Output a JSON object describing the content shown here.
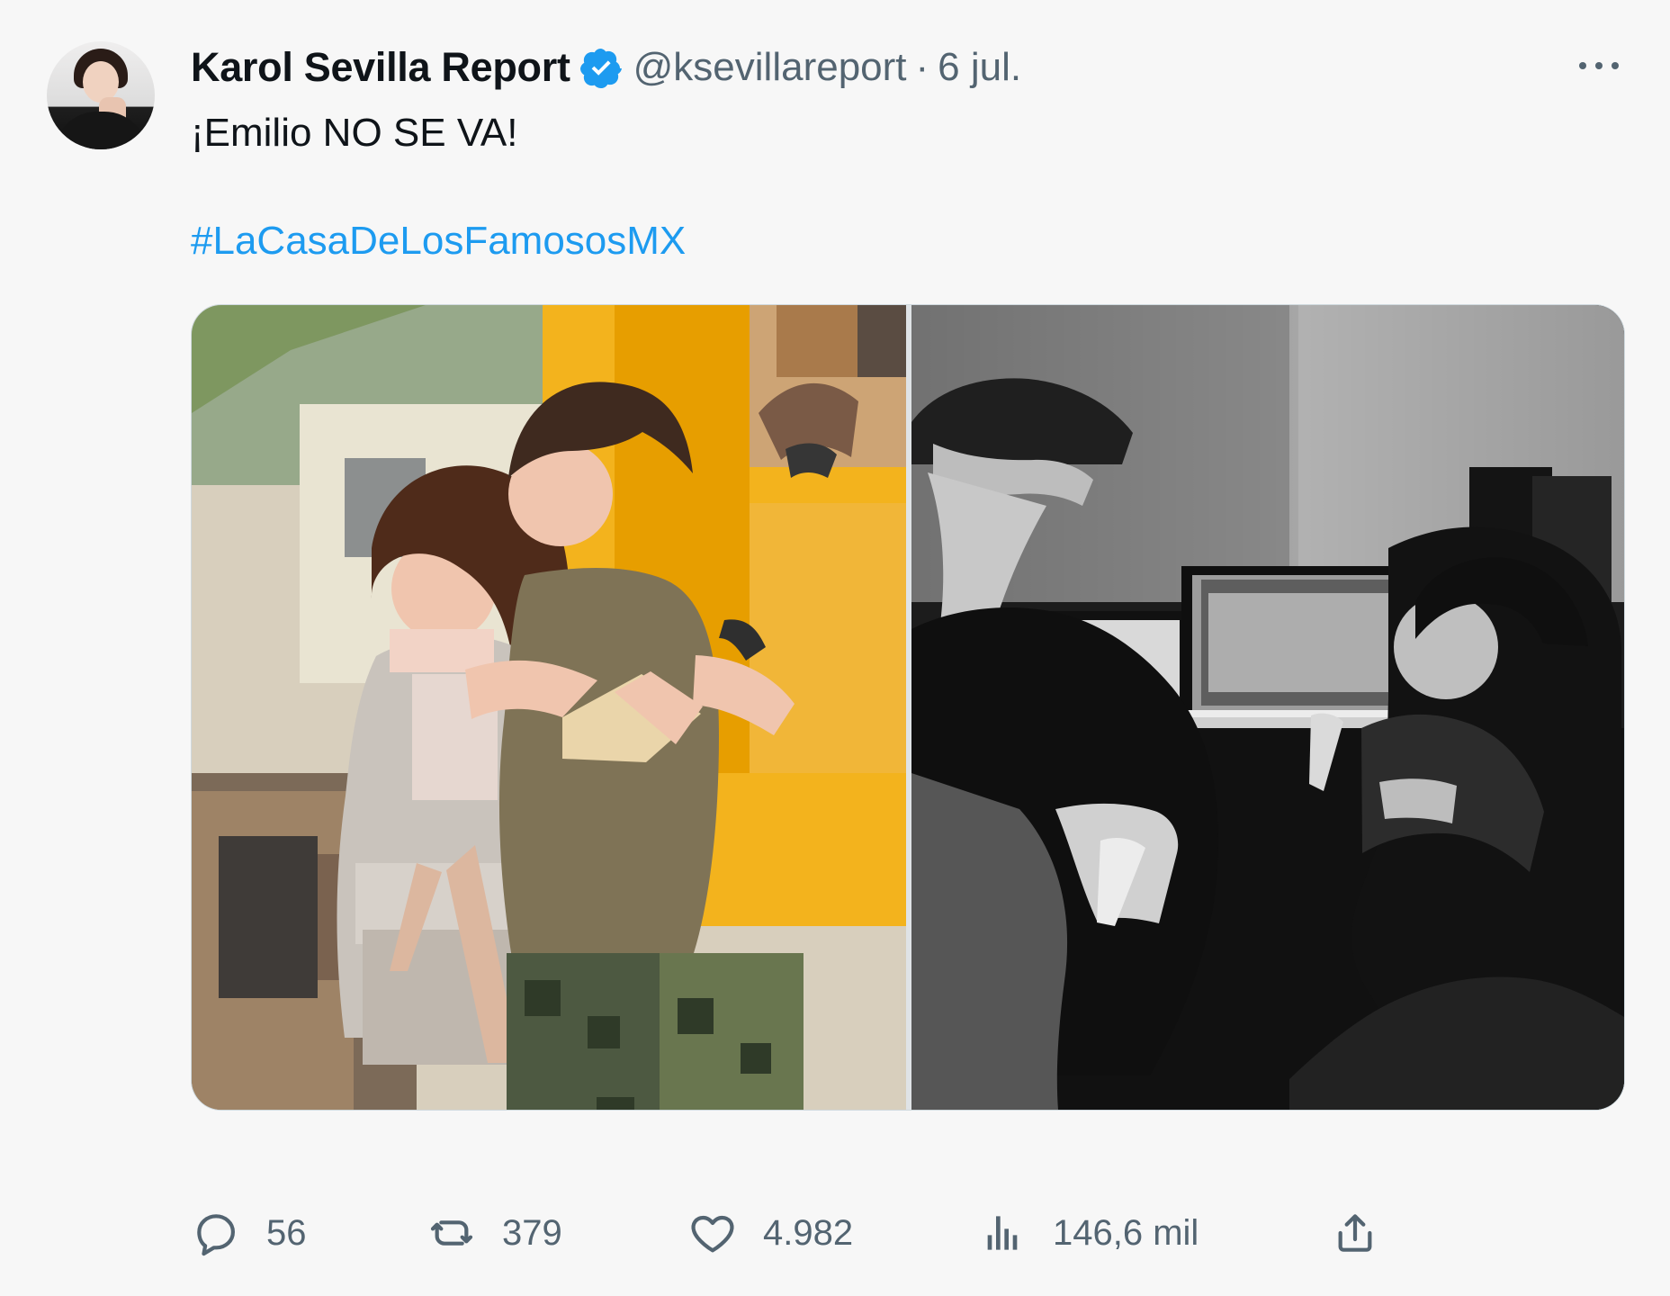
{
  "tweet": {
    "author_name": "Karol Sevilla Report",
    "author_handle": "@ksevillareport",
    "separator": "·",
    "date": "6 jul.",
    "text": "¡Emilio NO SE VA!",
    "hashtag": "#LaCasaDeLosFamososMX",
    "images": [
      {
        "name": "photo-left",
        "alt": ""
      },
      {
        "name": "photo-right",
        "alt": ""
      }
    ]
  },
  "actions": {
    "replies": "56",
    "retweets": "379",
    "likes": "4.982",
    "views": "146,6 mil"
  },
  "icons": {
    "verified": "verified-badge-icon",
    "more": "more-icon",
    "reply": "reply-icon",
    "retweet": "retweet-icon",
    "like": "heart-icon",
    "views": "views-icon",
    "share": "share-icon"
  },
  "colors": {
    "background": "#f7f7f7",
    "text": "#0f1419",
    "secondary": "#536471",
    "accent": "#1d9bf0"
  }
}
